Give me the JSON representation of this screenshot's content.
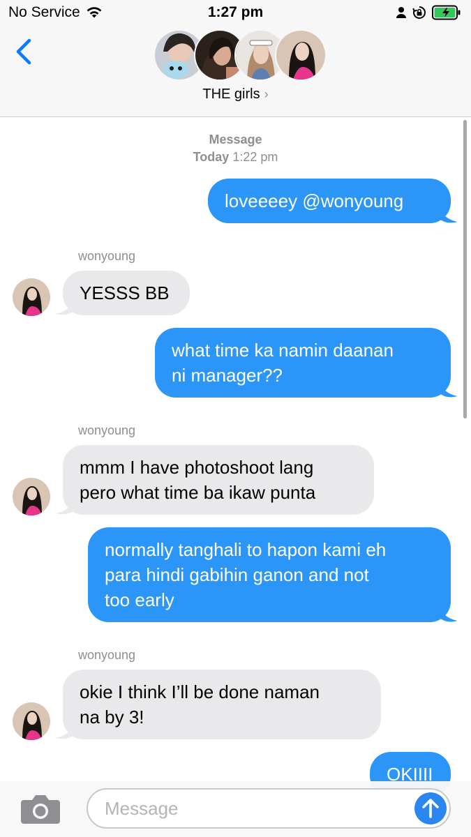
{
  "status_bar": {
    "carrier": "No Service",
    "time": "1:27 pm"
  },
  "header": {
    "back_icon": "chevron-left-icon",
    "group_name": "THE girls",
    "chevron": "›",
    "avatar_count": 4
  },
  "conversation": {
    "timestamp_label": "Message",
    "timestamp_day": "Today",
    "timestamp_time": "1:22 pm",
    "messages": [
      {
        "direction": "outgoing",
        "text": "loveeeey @wonyoung"
      },
      {
        "direction": "incoming",
        "sender": "wonyoung",
        "text": "YESSS BB"
      },
      {
        "direction": "outgoing",
        "lines": [
          "what time ka namin daanan",
          "ni manager??"
        ]
      },
      {
        "direction": "incoming",
        "sender": "wonyoung",
        "lines": [
          "mmm I have photoshoot lang",
          "pero what time ba ikaw punta"
        ]
      },
      {
        "direction": "outgoing",
        "lines": [
          "normally tanghali to hapon kami eh",
          "para hindi gabihin ganon and not",
          "too early"
        ]
      },
      {
        "direction": "incoming",
        "sender": "wonyoung",
        "lines": [
          "okie I think I’ll be done naman",
          "na by 3!"
        ]
      },
      {
        "direction": "outgoing",
        "text": "OKIIII"
      }
    ]
  },
  "input_bar": {
    "placeholder": "Message",
    "camera_icon": "camera-icon",
    "send_icon": "arrow-up-icon"
  },
  "colors": {
    "outgoing_bubble": "#2b95f8",
    "incoming_bubble": "#e9e9eb",
    "accent": "#0a7aff",
    "battery_fill": "#34c759"
  }
}
